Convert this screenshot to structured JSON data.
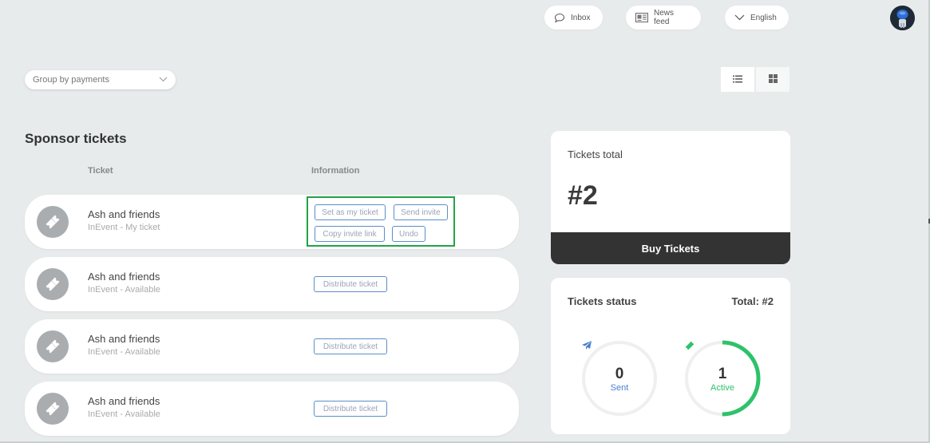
{
  "topbar": {
    "inbox_label": "Inbox",
    "newsfeed_label": "News feed",
    "language_label": "English"
  },
  "filters": {
    "group_by_selected": "Group by payments"
  },
  "section": {
    "title": "Sponsor tickets",
    "columns": [
      "Ticket",
      "Information"
    ]
  },
  "tickets": [
    {
      "name": "Ash and friends",
      "subtitle": "InEvent - My ticket",
      "actions": [
        "Set as my ticket",
        "Send invite",
        "Copy invite link",
        "Undo"
      ]
    },
    {
      "name": "Ash and friends",
      "subtitle": "InEvent - Available",
      "actions": [
        "Distribute ticket"
      ]
    },
    {
      "name": "Ash and friends",
      "subtitle": "InEvent - Available",
      "actions": [
        "Distribute ticket"
      ]
    },
    {
      "name": "Ash and friends",
      "subtitle": "InEvent - Available",
      "actions": [
        "Distribute ticket"
      ]
    }
  ],
  "tickets_total": {
    "label": "Tickets total",
    "value": "#2",
    "buy_label": "Buy Tickets"
  },
  "tickets_status": {
    "label": "Tickets status",
    "total_label": "Total: #2",
    "sent": {
      "value": "0",
      "label": "Sent",
      "color": "#4a7fd0",
      "fraction": 0
    },
    "active": {
      "value": "1",
      "label": "Active",
      "color": "#2ec26a",
      "fraction": 0.5
    }
  },
  "colors": {
    "highlight": "#22a447",
    "button_border": "#5b8fc7",
    "dark_button": "#333333"
  }
}
